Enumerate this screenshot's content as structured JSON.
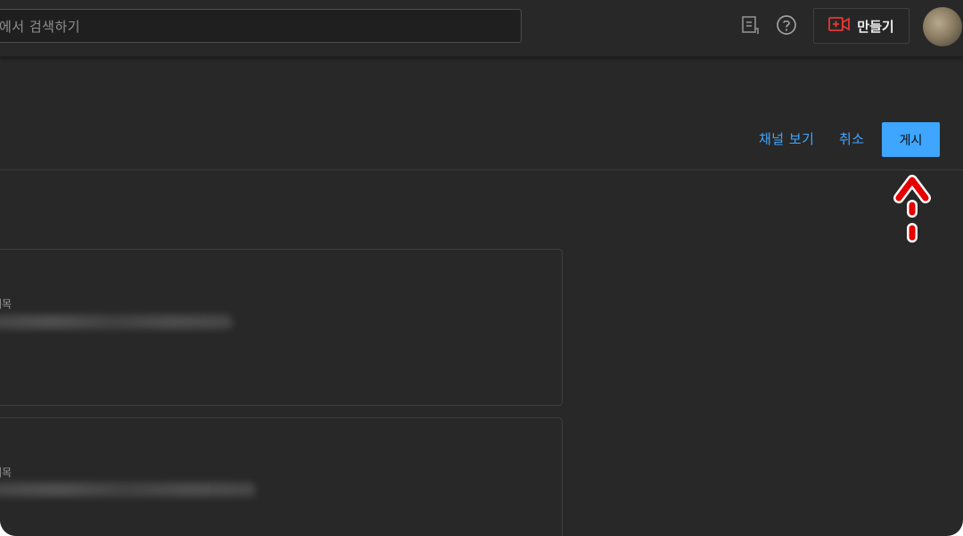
{
  "header": {
    "search": {
      "placeholder": "에서 검색하기"
    },
    "feedback_icon": "feedback-icon",
    "help_icon": "help-icon",
    "create": {
      "label": "만들기",
      "icon": "video-add-icon"
    },
    "avatar": "avatar"
  },
  "editor": {
    "view_channel_label": "채널 보기",
    "cancel_label": "취소",
    "publish_label": "게시"
  },
  "cards": [
    {
      "label": "제목"
    },
    {
      "label": "제목"
    }
  ],
  "colors": {
    "background": "#282828",
    "accent": "#3ea6ff",
    "annotation": "#e60000"
  }
}
